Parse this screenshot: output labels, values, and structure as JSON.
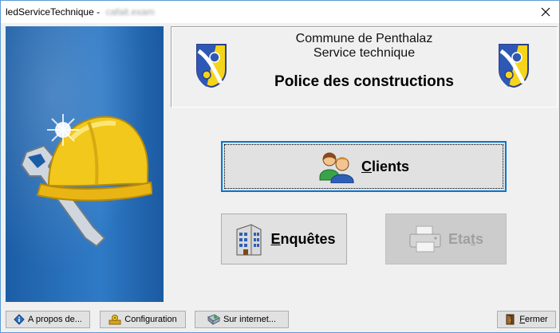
{
  "window": {
    "title": "ledServiceTechnique",
    "title_separator": "-",
    "title_obscured": "cafait.exam"
  },
  "header": {
    "commune": "Commune de Penthalaz",
    "service": "Service technique",
    "heading": "Police des constructions"
  },
  "buttons": {
    "clients": {
      "pre": "",
      "accel": "C",
      "post": "lients",
      "state": "focused"
    },
    "enquetes": {
      "pre": "",
      "accel": "E",
      "post": "nquêtes",
      "state": "enabled"
    },
    "etats": {
      "pre": "Eta",
      "accel": "t",
      "post": "s",
      "state": "disabled"
    }
  },
  "footer": {
    "about": "A propos de...",
    "configuration": "Configuration",
    "internet": "Sur internet...",
    "close": {
      "accel": "F",
      "post": "ermer"
    }
  },
  "colors": {
    "banner_blue": "#2b74bf",
    "focus_blue": "#0078d7",
    "disabled_text": "#a0a0a0"
  },
  "icons": {
    "banner": "hardhat-wrench-icon",
    "crest": "penthalaz-crest-icon",
    "clients": "people-icon",
    "enquetes": "building-icon",
    "etats": "printer-icon",
    "about": "info-icon",
    "configuration": "config-icon",
    "internet": "internet-icon",
    "close": "exit-door-icon"
  }
}
